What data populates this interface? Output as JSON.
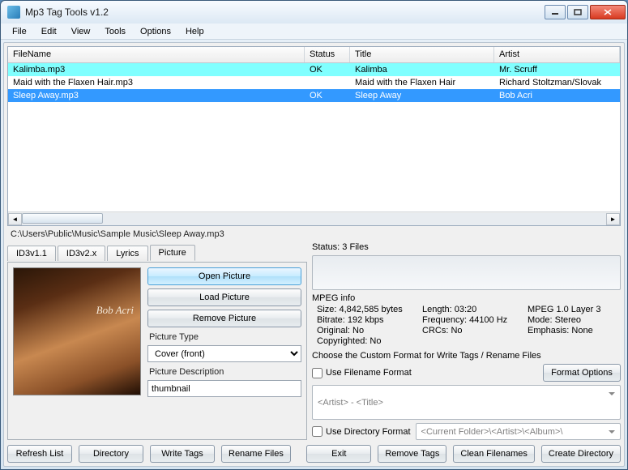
{
  "window": {
    "title": "Mp3 Tag Tools v1.2"
  },
  "menu": {
    "file": "File",
    "edit": "Edit",
    "view": "View",
    "tools": "Tools",
    "options": "Options",
    "help": "Help"
  },
  "grid": {
    "headers": {
      "filename": "FileName",
      "status": "Status",
      "title": "Title",
      "artist": "Artist"
    },
    "rows": [
      {
        "filename": "Kalimba.mp3",
        "status": "OK",
        "title": "Kalimba",
        "artist": "Mr. Scruff"
      },
      {
        "filename": "Maid with the Flaxen Hair.mp3",
        "status": "",
        "title": "Maid with the Flaxen Hair",
        "artist": "Richard Stoltzman/Slovak"
      },
      {
        "filename": "Sleep Away.mp3",
        "status": "OK",
        "title": "Sleep Away",
        "artist": "Bob Acri"
      }
    ]
  },
  "path": "C:\\Users\\Public\\Music\\Sample Music\\Sleep Away.mp3",
  "tabs": {
    "id3v11": "ID3v1.1",
    "id3v2x": "ID3v2.x",
    "lyrics": "Lyrics",
    "picture": "Picture"
  },
  "picture_tab": {
    "open": "Open Picture",
    "load": "Load Picture",
    "remove": "Remove Picture",
    "type_label": "Picture Type",
    "type_value": "Cover (front)",
    "desc_label": "Picture Description",
    "desc_value": "thumbnail",
    "art_line1": "",
    "art_line2": "Bob Acri",
    "art_line3": ""
  },
  "status": {
    "label": "Status: 3 Files"
  },
  "mpeg": {
    "title": "MPEG info",
    "size": "Size: 4,842,585 bytes",
    "length": "Length:  03:20",
    "layer": "MPEG 1.0 Layer 3",
    "bitrate": "Bitrate: 192 kbps",
    "freq": "Frequency: 44100 Hz",
    "mode": "Mode: Stereo",
    "original": "Original: No",
    "crcs": "CRCs: No",
    "emphasis": "Emphasis: None",
    "copyright": "Copyrighted: No"
  },
  "custom": {
    "title": "Choose the Custom Format for Write Tags / Rename Files",
    "use_filename": "Use Filename Format",
    "format_options": "Format Options",
    "filename_combo": "<Artist> - <Title>",
    "use_directory": "Use Directory Format",
    "directory_combo": "<Current Folder>\\<Artist>\\<Album>\\"
  },
  "buttons": {
    "refresh": "Refresh List",
    "directory": "Directory",
    "write_tags": "Write Tags",
    "rename_files": "Rename Files",
    "exit": "Exit",
    "remove_tags": "Remove Tags",
    "clean_filenames": "Clean Filenames",
    "create_directory": "Create Directory"
  }
}
